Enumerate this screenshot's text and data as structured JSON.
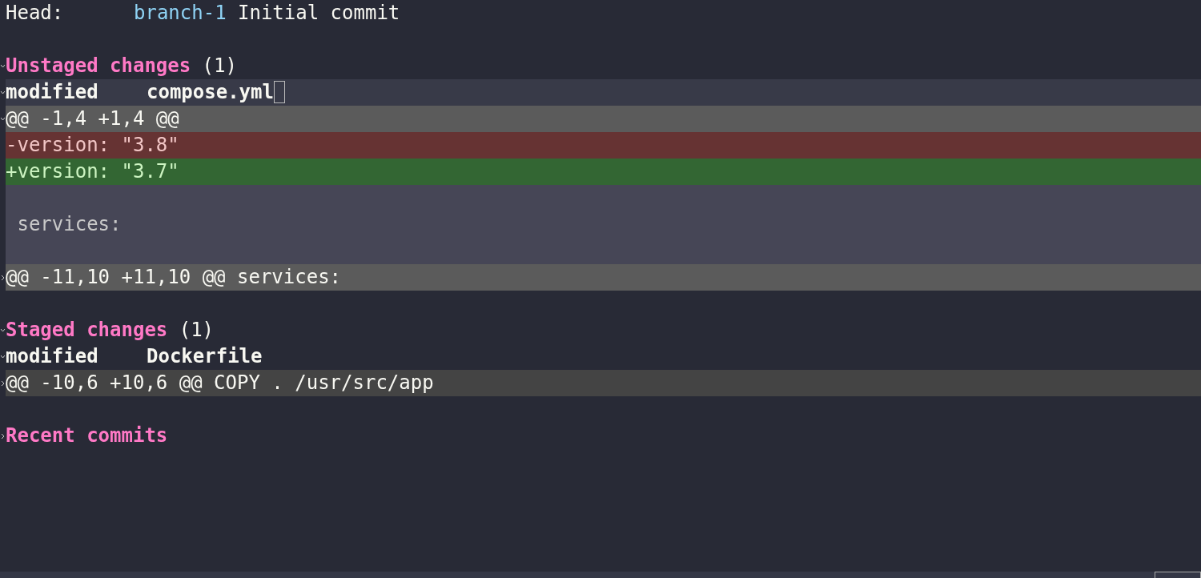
{
  "head": {
    "label": "Head:",
    "branch": "branch-1",
    "message": "Initial commit"
  },
  "sections": [
    {
      "title": "Unstaged changes",
      "count": "(1)",
      "expanded": true,
      "files": [
        {
          "status": "modified",
          "path": "compose.yml",
          "cursor": true,
          "highlighted": true,
          "expanded": true,
          "hunks": [
            {
              "header": "@@ -1,4 +1,4 @@",
              "expanded": true,
              "lines": [
                {
                  "kind": "removed",
                  "text": "-version: \"3.8\""
                },
                {
                  "kind": "added",
                  "text": "+version: \"3.7\""
                },
                {
                  "kind": "blank"
                },
                {
                  "kind": "context",
                  "text": " services:"
                },
                {
                  "kind": "blank"
                }
              ]
            },
            {
              "header": "@@ -11,10 +11,10 @@ services:",
              "expanded": false
            }
          ]
        }
      ]
    },
    {
      "title": "Staged changes",
      "count": "(1)",
      "expanded": true,
      "files": [
        {
          "status": "modified",
          "path": "Dockerfile",
          "cursor": false,
          "highlighted": false,
          "expanded": true,
          "hunks": [
            {
              "header": "@@ -10,6 +10,6 @@ COPY . /usr/src/app",
              "expanded": false
            }
          ]
        }
      ]
    },
    {
      "title": "Recent commits",
      "expanded": false
    }
  ]
}
